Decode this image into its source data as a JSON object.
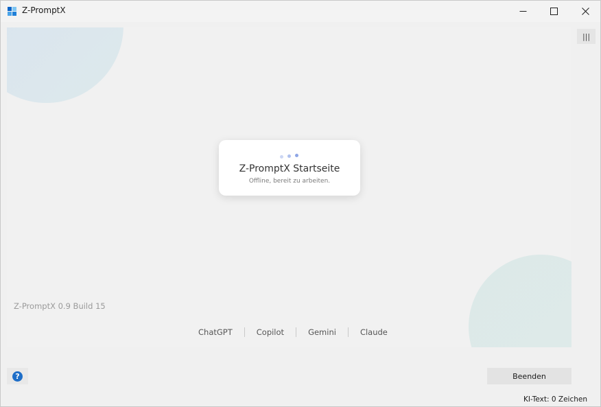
{
  "window": {
    "title": "Z-PromptX"
  },
  "card": {
    "title": "Z-PromptX Startseite",
    "subtitle": "Offline, bereit zu arbeiten."
  },
  "version": "Z-PromptX 0.9 Build 15",
  "links": [
    "ChatGPT",
    "Copilot",
    "Gemini",
    "Claude"
  ],
  "side_toggle": {
    "glyph": "|||"
  },
  "help": {
    "glyph": "?"
  },
  "quit_button": {
    "label": "Beenden"
  },
  "status": {
    "text": "KI-Text: 0 Zeichen"
  },
  "colors": {
    "accent": "#1e6ec8",
    "dots": "#8ea6e6"
  }
}
